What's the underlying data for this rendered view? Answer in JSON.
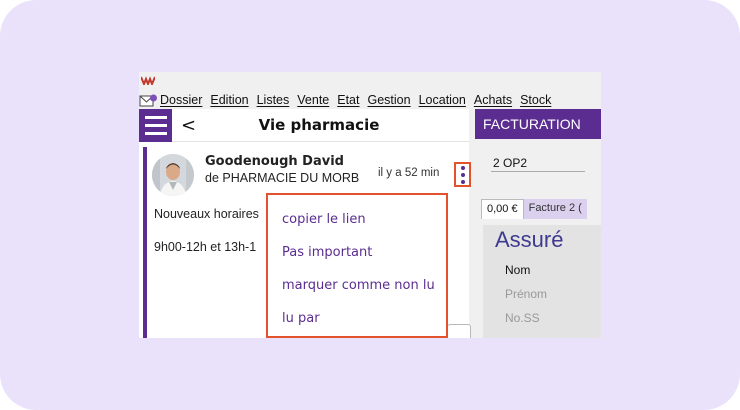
{
  "menubar": {
    "items": [
      "Dossier",
      "Edition",
      "Listes",
      "Vente",
      "Etat",
      "Gestion",
      "Location",
      "Achats",
      "Stock"
    ]
  },
  "left_panel": {
    "title": "Vie pharmacie",
    "back_glyph": "<",
    "message": {
      "sender_name": "Goodenough David",
      "sender_org": "de PHARMACIE DU MORB",
      "time": "il y a 52 min",
      "line1": "Nouveaux horaires",
      "line2": "9h00-12h et 13h-1"
    }
  },
  "context_menu": {
    "items": [
      "copier le lien",
      "Pas important",
      "marquer comme non lu",
      "lu par"
    ]
  },
  "right_panel": {
    "bar_title": "FACTURATION",
    "field_value": "2 OP2",
    "tab_amount": "0,00 €",
    "tab_invoice": "Facture 2 (",
    "section_title": "Assuré",
    "labels": [
      "Nom",
      "Prénom",
      "No.SS"
    ]
  },
  "colors": {
    "accent": "#5b2d91",
    "highlight_border": "#e2522d",
    "card_background": "#eae2fb"
  },
  "icons": [
    "app-logo-icon",
    "mail-icon",
    "hamburger-icon",
    "back-icon",
    "kebab-menu-icon",
    "avatar"
  ]
}
